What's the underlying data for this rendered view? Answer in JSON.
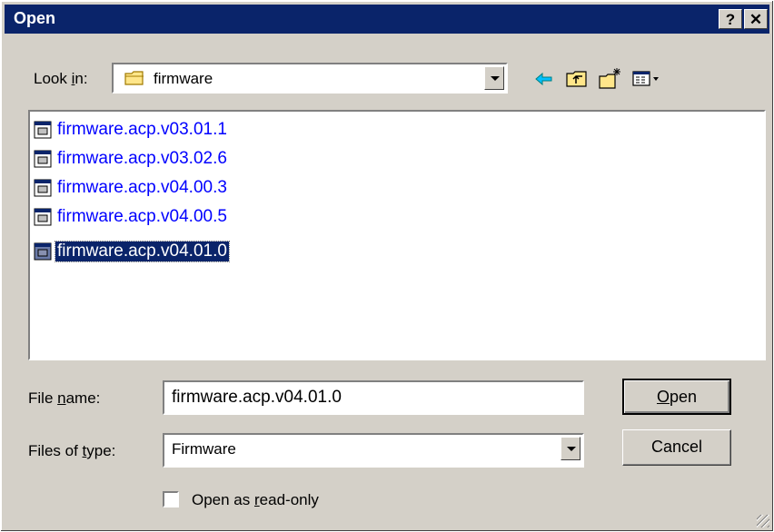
{
  "window": {
    "title": "Open",
    "help_label": "?",
    "close_label": "✕"
  },
  "lookin": {
    "label_pre": "Look ",
    "label_accel": "i",
    "label_post": "n:",
    "value": "firmware"
  },
  "toolbar": [
    {
      "name": "back-icon"
    },
    {
      "name": "up-one-level-icon"
    },
    {
      "name": "new-folder-icon"
    },
    {
      "name": "view-menu-icon"
    }
  ],
  "files": [
    {
      "name": "firmware.acp.v03.01.1",
      "selected": false
    },
    {
      "name": "firmware.acp.v03.02.6",
      "selected": false
    },
    {
      "name": "firmware.acp.v04.00.3",
      "selected": false
    },
    {
      "name": "firmware.acp.v04.00.5",
      "selected": false
    },
    {
      "name": "firmware.acp.v04.01.0",
      "selected": true
    }
  ],
  "filename": {
    "label_pre": "File ",
    "label_accel": "n",
    "label_post": "ame:",
    "value": "firmware.acp.v04.01.0"
  },
  "filetype": {
    "label_pre": "Files of ",
    "label_accel": "t",
    "label_post": "ype:",
    "value": "Firmware"
  },
  "buttons": {
    "open_accel": "O",
    "open_rest": "pen",
    "cancel": "Cancel"
  },
  "readonly": {
    "label_pre": "Open as ",
    "label_accel": "r",
    "label_post": "ead-only",
    "checked": false
  },
  "colors": {
    "title_bar": "#0a246a",
    "face": "#d4d0c8",
    "link": "#0000ff"
  }
}
